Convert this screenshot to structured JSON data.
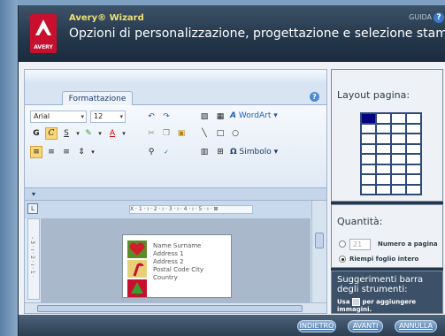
{
  "header": {
    "brand": "Avery® Wizard",
    "logo_text": "AVERY",
    "title": "Opzioni di personalizzazione, progettazione e selezione stampa",
    "help_label": "GUIDA",
    "help_icon": "?"
  },
  "editor": {
    "tab": "Formattazione",
    "font_family": "Arial",
    "font_size": "12",
    "wordart_label": "WordArt",
    "simbolo_label": "Simbolo",
    "ruler_text": "X · 1 · ı · 2 · ı · 3 · ı · 4 · ı · 5 · ı · ⊠",
    "ruler_corner": "L",
    "vertical_ruler": "- 3 · ı · 2 · ı · 1 ·",
    "label": {
      "lines": [
        "Name Surname",
        "Address 1",
        "Address 2",
        "Postal Code City",
        "Country"
      ]
    }
  },
  "layout_panel": {
    "title": "Layout pagina:",
    "grid": {
      "cols": 4,
      "rows": 8,
      "selected": [
        0,
        0
      ]
    },
    "selected_color": "#000080"
  },
  "quantity_panel": {
    "title": "Quantità:",
    "number_value": "21",
    "option_number": "Numero a pagina",
    "option_fill": "Riempi foglio intero"
  },
  "tips_panel": {
    "title": "Suggerimenti barra degli strumenti:",
    "text_before": "Usa",
    "text_after": "per aggiungere immagini."
  },
  "footer": {
    "back": "INDIETRO",
    "next": "AVANTI",
    "cancel": "ANNULLA"
  }
}
